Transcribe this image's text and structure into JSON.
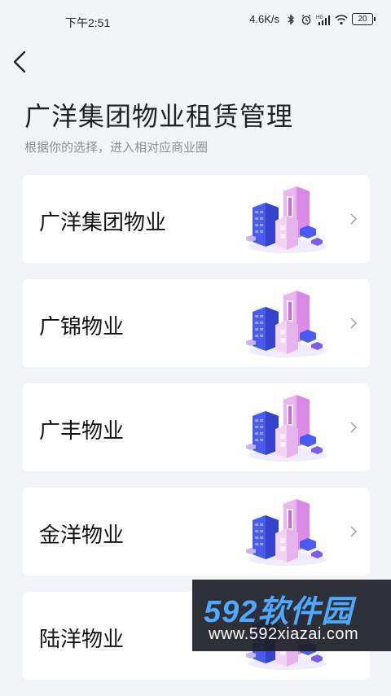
{
  "status_bar": {
    "time": "下午2:51",
    "net_speed": "4.6K/s",
    "battery": "20",
    "icons": [
      "bluetooth-icon",
      "alarm-icon",
      "hd-signal-icon",
      "wifi-icon",
      "battery-icon"
    ]
  },
  "header": {
    "back_icon": "chevron-left-icon",
    "title": "广洋集团物业租赁管理",
    "subtitle": "根据你的选择，进入相对应商业圈"
  },
  "cards": [
    {
      "label": "广洋集团物业",
      "art": "isometric-building-illustration",
      "chevron": "chevron-right-icon"
    },
    {
      "label": "广锦物业",
      "art": "isometric-building-illustration",
      "chevron": "chevron-right-icon"
    },
    {
      "label": "广丰物业",
      "art": "isometric-building-illustration",
      "chevron": "chevron-right-icon"
    },
    {
      "label": "金洋物业",
      "art": "isometric-building-illustration",
      "chevron": "chevron-right-icon"
    },
    {
      "label": "陆洋物业",
      "art": "isometric-building-illustration",
      "chevron": "chevron-right-icon"
    }
  ],
  "watermark": {
    "brand": "592软件园",
    "url": "www.592xiazai.com"
  },
  "colors": {
    "background": "#f3f4f7",
    "card": "#ffffff",
    "title": "#1f2329",
    "subtitle": "#8a8f99",
    "illustration_blue": "#4a5cf0",
    "illustration_pink": "#e9a8f0",
    "watermark_blue": "#4fa9ff"
  }
}
